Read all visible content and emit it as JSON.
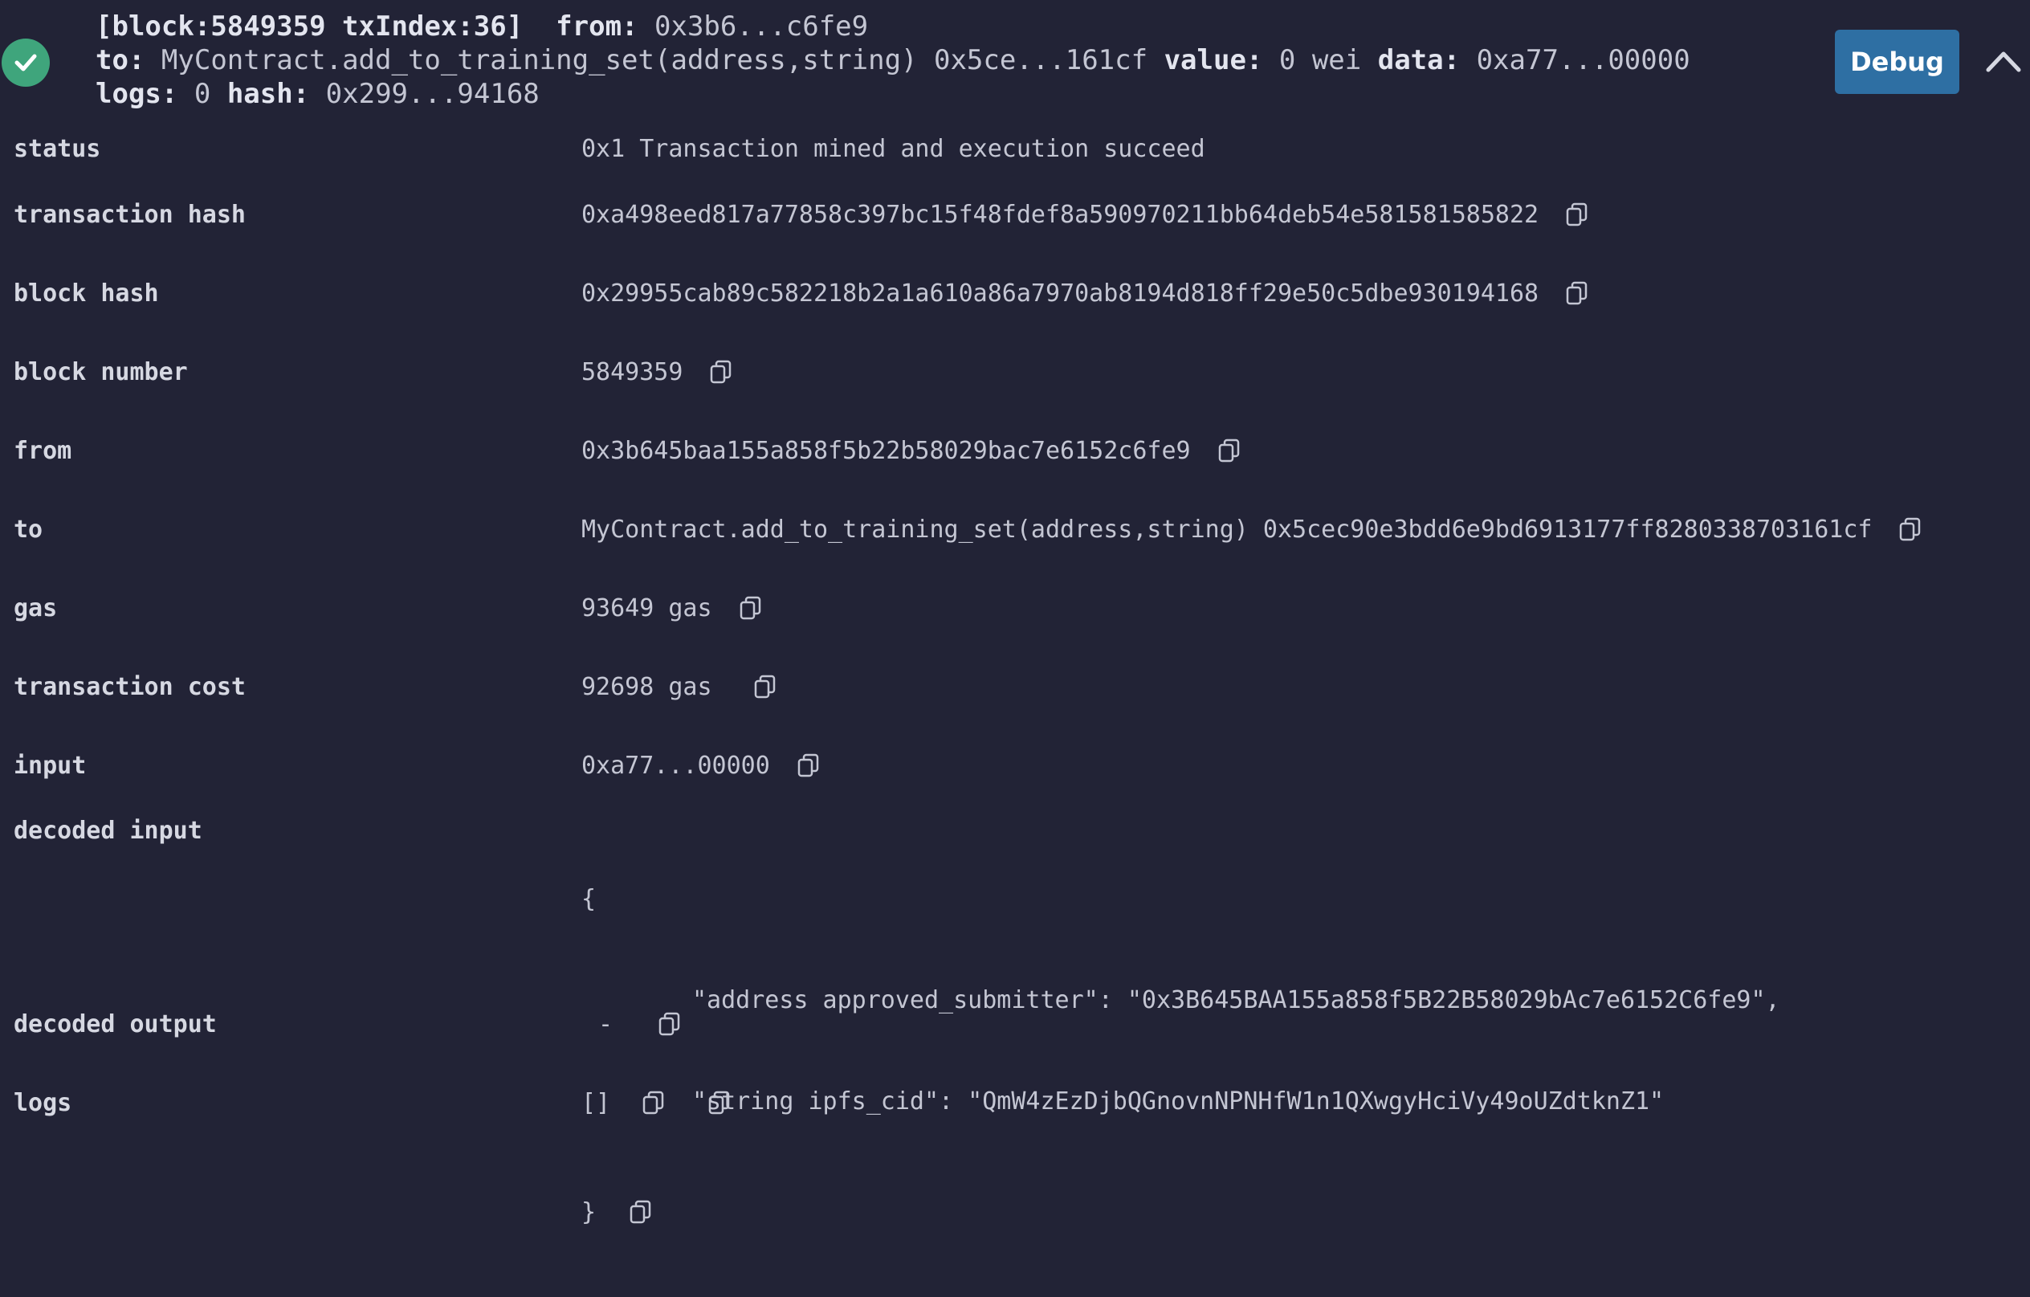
{
  "header": {
    "line1": {
      "block_info": "[block:5849359 txIndex:36]",
      "from_label": "from:",
      "from_value": "0x3b6...c6fe9"
    },
    "line2": {
      "to_label": "to:",
      "to_value": "MyContract.add_to_training_set(address,string) 0x5ce...161cf",
      "value_label": "value:",
      "value_value": "0 wei",
      "data_label": "data:",
      "data_value": "0xa77...00000"
    },
    "line3": {
      "logs_label": "logs:",
      "logs_value": "0",
      "hash_label": "hash:",
      "hash_value": "0x299...94168"
    },
    "debug_label": "Debug",
    "status_icon": "check-circle-icon",
    "collapse_icon": "chevron-up-icon"
  },
  "rows": {
    "status": {
      "label": "status",
      "value": "0x1 Transaction mined and execution succeed"
    },
    "transaction_hash": {
      "label": "transaction hash",
      "value": "0xa498eed817a77858c397bc15f48fdef8a590970211bb64deb54e581581585822"
    },
    "block_hash": {
      "label": "block hash",
      "value": "0x29955cab89c582218b2a1a610a86a7970ab8194d818ff29e50c5dbe930194168"
    },
    "block_number": {
      "label": "block number",
      "value": "5849359"
    },
    "from": {
      "label": "from",
      "value": "0x3b645baa155a858f5b22b58029bac7e6152c6fe9"
    },
    "to": {
      "label": "to",
      "value": "MyContract.add_to_training_set(address,string) 0x5cec90e3bdd6e9bd6913177ff8280338703161cf"
    },
    "gas": {
      "label": "gas",
      "value": "93649 gas"
    },
    "transaction_cost": {
      "label": "transaction cost",
      "value": "92698 gas"
    },
    "input": {
      "label": "input",
      "value": "0xa77...00000"
    },
    "decoded_input": {
      "label": "decoded input",
      "open": "{",
      "line1": "\"address approved_submitter\": \"0x3B645BAA155a858f5B22B58029bAc7e6152C6fe9\",",
      "line2": "\"string ipfs_cid\": \"QmW4zEzDjbQGnovnNPNHfW1n1QXwgyHciVy49oUZdtknZ1\"",
      "close": "}"
    },
    "decoded_output": {
      "label": "decoded output",
      "value": "-"
    },
    "logs": {
      "label": "logs",
      "value": "[]"
    }
  },
  "colors": {
    "background": "#222336",
    "success": "#3fa57c",
    "debug_button": "#2e6fa3",
    "text": "#c4c6d3"
  }
}
